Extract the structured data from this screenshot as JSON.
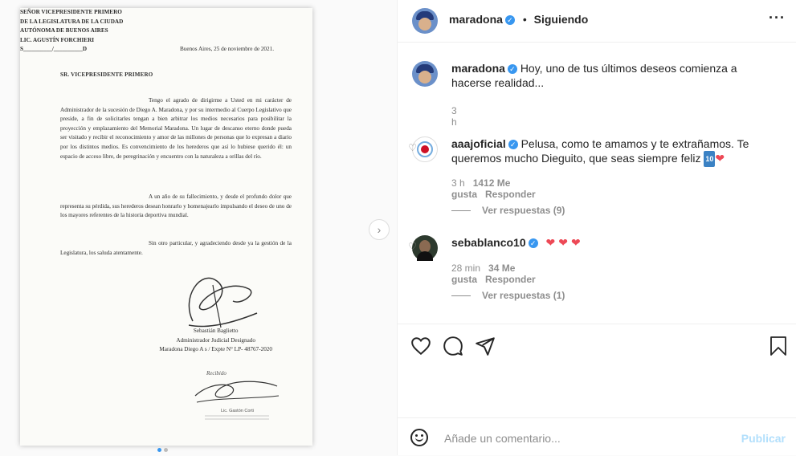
{
  "document": {
    "date": "Buenos Aires, 25 de noviembre de 2021.",
    "addressee": "SR. VICEPRESIDENTE PRIMERO",
    "paragraph1": "Tengo el agrado de dirigirme a Usted en mi carácter de Administrador de la sucesión de Diego A. Maradona, y por su intermedio al Cuerpo Legislativo que preside, a fin de solicitarles tengan a bien arbitrar los medios necesarios para posibilitar la proyección y emplazamiento del Memorial Maradona. Un lugar de descanso eterno donde pueda ser visitado y recibir el reconocimiento y amor de las millones de personas que lo expresan a diario por los distintos medios. Es convencimiento de los herederos que así lo hubiese querido él: un espacio de acceso libre, de peregrinación y encuentro con la naturaleza a orillas del río.",
    "paragraph2": "A un año de su fallecimiento, y desde el profundo dolor que representa su pérdida, sus herederos desean honrarlo y homenajearlo impulsando el deseo de uno de los mayores referentes de la historia deportiva mundial.",
    "paragraph3": "Sin otro particular, y agradeciendo desde ya la gestión de la Legislatura, los saluda atentamente.",
    "signer_name": "Sebastián Baglietto",
    "signer_role": "Administrador Judicial Designado",
    "signer_case": "Maradona Diego A s / Expte N° LP- 48767-2020",
    "footer_line1": "SEÑOR VICEPRESIDENTE PRIMERO",
    "footer_line2": "DE LA LEGISLATURA DE LA CIUDAD",
    "footer_line3": "AUTÓNOMA DE BUENOS AIRES",
    "footer_line4": "LIC. AGUSTÍN FORCHIERI",
    "footer_line5": "S__________/__________D",
    "stamp_received": "Recibido",
    "stamp_name": "Lic. Gastón Corti"
  },
  "header": {
    "username": "maradona",
    "separator": "•",
    "follow_status": "Siguiendo",
    "more_icon": "more-horizontal-icon"
  },
  "caption": {
    "username": "maradona",
    "text": "Hoy, uno de tus últimos deseos comienza a hacerse realidad...",
    "time": "3 h"
  },
  "comments": [
    {
      "username": "aaajoficial",
      "text": "Pelusa, como te amamos y te extrañamos. Te queremos mucho Dieguito, que seas siempre feliz",
      "emoji_badge": "10",
      "time": "3 h",
      "likes": "1412 Me gusta",
      "reply_label": "Responder",
      "view_replies": "Ver respuestas (9)"
    },
    {
      "username": "sebablanco10",
      "text": "",
      "time": "28 min",
      "likes": "34 Me gusta",
      "reply_label": "Responder",
      "view_replies": "Ver respuestas (1)"
    }
  ],
  "add_comment": {
    "placeholder": "Añade un comentario...",
    "post_label": "Publicar"
  },
  "colors": {
    "verified": "#3897f0",
    "heart": "#ed4956",
    "publish_disabled": "#b2dffc",
    "meta_gray": "#8e8e8e"
  }
}
